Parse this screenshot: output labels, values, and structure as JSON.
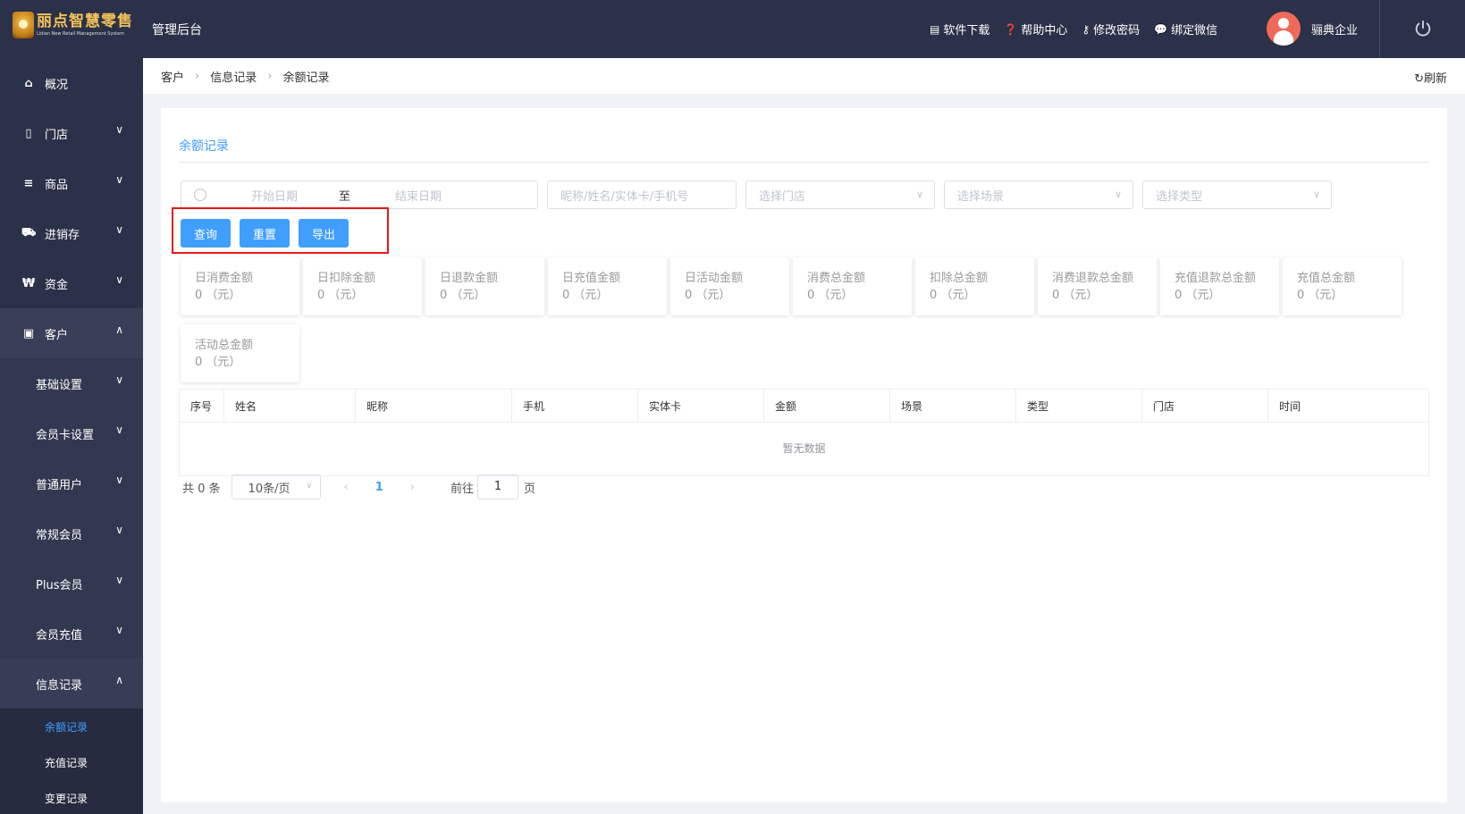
{
  "header": {
    "logo_text": "丽点智慧零售",
    "logo_subtext": "Lidian New Retail Management System",
    "admin_title": "管理后台",
    "menu": [
      {
        "label": "软件下载",
        "icon": "store-icon"
      },
      {
        "label": "帮助中心",
        "icon": "help-icon"
      },
      {
        "label": "修改密码",
        "icon": "key-icon"
      },
      {
        "label": "绑定微信",
        "icon": "wechat-icon"
      }
    ],
    "username": "骊典企业"
  },
  "sidebar": {
    "items": [
      {
        "label": "概况",
        "icon": "home-icon"
      },
      {
        "label": "门店",
        "icon": "store-doc-icon"
      },
      {
        "label": "商品",
        "icon": "list-icon"
      },
      {
        "label": "进销存",
        "icon": "truck-icon"
      },
      {
        "label": "资金",
        "icon": "won-icon"
      },
      {
        "label": "客户",
        "icon": "id-card-icon"
      }
    ],
    "sub_items": [
      "基础设置",
      "会员卡设置",
      "普通用户",
      "常规会员",
      "Plus会员",
      "会员充值",
      "信息记录"
    ],
    "leaf_items": [
      "余额记录",
      "充值记录",
      "变更记录"
    ]
  },
  "breadcrumb": [
    "客户",
    "信息记录",
    "余额记录"
  ],
  "refresh_label": "刷新",
  "page": {
    "title": "余额记录",
    "filters": {
      "start_date": "开始日期",
      "range_sep": "至",
      "end_date": "结束日期",
      "keyword": "昵称/姓名/实体卡/手机号",
      "store": "选择门店",
      "scene": "选择场景",
      "type": "选择类型"
    },
    "buttons": {
      "query": "查询",
      "reset": "重置",
      "export": "导出"
    },
    "stats": [
      {
        "label": "日消费金额",
        "value": "0 （元）"
      },
      {
        "label": "日扣除金额",
        "value": "0 （元）"
      },
      {
        "label": "日退款金额",
        "value": "0 （元）"
      },
      {
        "label": "日充值金额",
        "value": "0 （元）"
      },
      {
        "label": "日活动金额",
        "value": "0 （元）"
      },
      {
        "label": "消费总金额",
        "value": "0 （元）"
      },
      {
        "label": "扣除总金额",
        "value": "0 （元）"
      },
      {
        "label": "消费退款总金额",
        "value": "0 （元）"
      },
      {
        "label": "充值退款总金额",
        "value": "0 （元）"
      },
      {
        "label": "充值总金额",
        "value": "0 （元）"
      },
      {
        "label": "活动总金额",
        "value": "0 （元）"
      }
    ],
    "table": {
      "columns": [
        "序号",
        "姓名",
        "昵称",
        "手机",
        "实体卡",
        "金额",
        "场景",
        "类型",
        "门店",
        "时间"
      ],
      "empty_text": "暂无数据"
    },
    "pagination": {
      "total_text": "共 0 条",
      "page_size": "10条/页",
      "current_page": "1",
      "goto_label": "前往",
      "goto_value": "1",
      "goto_suffix": "页"
    }
  },
  "colors": {
    "primary": "#409eff",
    "nav_bg": "#2b3148",
    "highlight": "#e81a1a"
  }
}
